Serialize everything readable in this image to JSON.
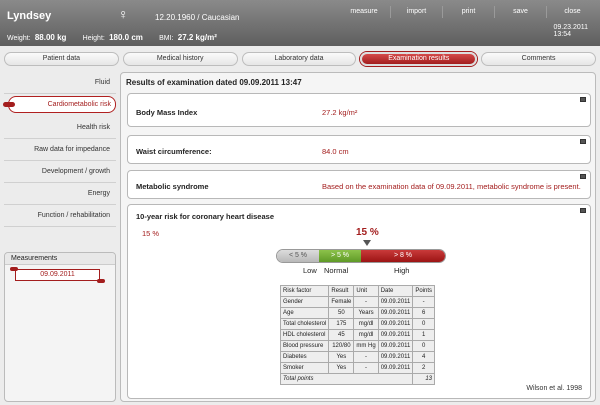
{
  "patient": {
    "name": "Lyndsey",
    "gender_symbol": "♀",
    "dob_ethnicity": "12.20.1960  /  Caucasian",
    "weight_label": "Weight:",
    "weight_value": "88.00 kg",
    "height_label": "Height:",
    "height_value": "180.0 cm",
    "bmi_label": "BMI:",
    "bmi_value": "27.2 kg/m²"
  },
  "toolbar": [
    "measure",
    "import",
    "print",
    "save",
    "close"
  ],
  "header_date": "09.23.2011",
  "header_time": "13:54",
  "tabs": [
    "Patient data",
    "Medical history",
    "Laboratory data",
    "Examination results",
    "Comments"
  ],
  "active_tab": 3,
  "sidebar": [
    "Fluid",
    "Cardiometabolic risk",
    "Health risk",
    "Raw data for impedance",
    "Development / growth",
    "Energy",
    "Function / rehabilitation"
  ],
  "active_sidebar": 1,
  "measurements": {
    "title": "Measurements",
    "items": [
      "09.09.2011"
    ]
  },
  "results": {
    "title": "Results of examination dated  09.09.2011 13:47",
    "bmi": {
      "label": "Body Mass Index",
      "value": "27.2 kg/m²"
    },
    "waist": {
      "label": "Waist circumference:",
      "value": "84.0 cm"
    },
    "metabolic": {
      "label": "Metabolic syndrome",
      "value": "Based on the examination data of 09.09.2011, metabolic syndrome is present."
    },
    "risk": {
      "label": "10-year risk for coronary heart disease",
      "percent": "15 %",
      "value_display": "15 %",
      "scale": {
        "low_text": "< 5 %",
        "normal_text": "> 5 %",
        "high_text": "> 8 %",
        "low_label": "Low",
        "normal_label": "Normal",
        "high_label": "High"
      },
      "table": {
        "headers": [
          "Risk factor",
          "Result",
          "Unit",
          "Date",
          "Points"
        ],
        "rows": [
          [
            "Gender",
            "Female",
            "-",
            "09.09.2011",
            "-"
          ],
          [
            "Age",
            "50",
            "Years",
            "09.09.2011",
            "6"
          ],
          [
            "Total cholesterol",
            "175",
            "mg/dl",
            "09.09.2011",
            "0"
          ],
          [
            "HDL cholesterol",
            "45",
            "mg/dl",
            "09.09.2011",
            "1"
          ],
          [
            "Blood pressure",
            "120/80",
            "mm Hg",
            "09.09.2011",
            "0"
          ],
          [
            "Diabetes",
            "Yes",
            "-",
            "09.09.2011",
            "4"
          ],
          [
            "Smoker",
            "Yes",
            "-",
            "09.09.2011",
            "2"
          ]
        ],
        "total_label": "Total points",
        "total_value": "13"
      },
      "citation": "Wilson et al. 1998"
    }
  },
  "colors": {
    "accent": "#a31d1d",
    "normal": "#6aa82e",
    "header": "#6e6e6e"
  }
}
